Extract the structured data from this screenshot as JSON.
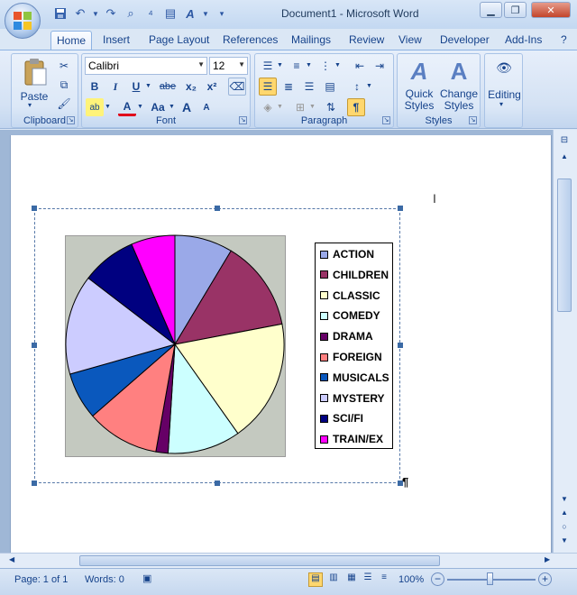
{
  "window": {
    "title": "Document1 - Microsoft Word"
  },
  "tabs": [
    "Home",
    "Insert",
    "Page Layout",
    "References",
    "Mailings",
    "Review",
    "View",
    "Developer",
    "Add-Ins"
  ],
  "ribbon": {
    "clipboard": {
      "label": "Clipboard",
      "paste": "Paste"
    },
    "font": {
      "label": "Font",
      "name": "Calibri",
      "size": "12",
      "bold": "B",
      "italic": "I",
      "underline": "U",
      "strike": "abe",
      "sub": "x₂",
      "sup": "x²",
      "grow": "A",
      "shrink": "A",
      "case": "Aa"
    },
    "paragraph": {
      "label": "Paragraph"
    },
    "styles": {
      "label": "Styles",
      "quick": "Quick",
      "quick2": "Styles",
      "change": "Change",
      "change2": "Styles"
    },
    "editing": {
      "label": "Editing"
    }
  },
  "status": {
    "page": "Page: 1 of 1",
    "words": "Words: 0",
    "zoom": "100%"
  },
  "colors": {
    "accent": "#15428b",
    "selection": "#ffd76e"
  },
  "chart_data": {
    "type": "pie",
    "categories": [
      "ACTION",
      "CHILDREN",
      "CLASSIC",
      "COMEDY",
      "DRAMA",
      "FOREIGN",
      "MUSICALS",
      "MYSTERY",
      "SCI/FI",
      "TRAIN/EX"
    ],
    "values": [
      8.6,
      13.4,
      18.2,
      10.8,
      1.8,
      10.8,
      7.0,
      14.8,
      8.1,
      6.5
    ],
    "colors": [
      "#9aa9e8",
      "#993366",
      "#ffffcc",
      "#ccffff",
      "#660066",
      "#ff8080",
      "#0a58bd",
      "#ccccff",
      "#000080",
      "#ff00ff"
    ],
    "legend_position": "right"
  }
}
